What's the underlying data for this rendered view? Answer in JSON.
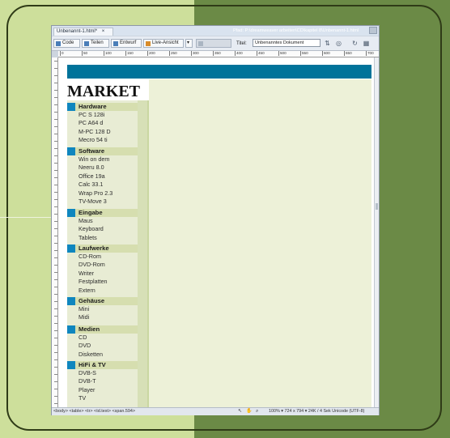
{
  "colors": {
    "bg_left": "#cddf9b",
    "bg_right": "#6b8a46",
    "accent_bar": "#00739a",
    "category_square": "#0f86be",
    "category_header": "#d6deaf",
    "sidebar": "#e8ecd4",
    "content": "#edf1d8"
  },
  "window": {
    "doc_tab": "Unbenannt-1.html*",
    "close_glyph": "×",
    "path": "Pfad: P:\\dreamweaver arbeiten\\CD\\kapitel 8\\Unbenannt-1.html"
  },
  "toolbar": {
    "code_label": "Code",
    "split_label": "Teilen",
    "design_label": "Entwurf",
    "live_view_label": "Live-Ansicht",
    "title_label": "Titel:",
    "title_value": "Unbenanntes Dokument"
  },
  "ruler": {
    "marks": [
      "0",
      "50",
      "100",
      "150",
      "200",
      "250",
      "300",
      "350",
      "400",
      "450",
      "500",
      "550",
      "600",
      "650",
      "700"
    ]
  },
  "page": {
    "title": "MARKET",
    "categories": [
      {
        "name": "Hardware",
        "items": [
          "PC S 128i",
          "PC A64 d",
          "M-PC 128 D",
          "Mecro 54 ti"
        ]
      },
      {
        "name": "Software",
        "items": [
          "Win on dem",
          "Neeru 8.0",
          "Office 19a",
          "Calc 33.1",
          "Wrap Pro 2.3",
          "TV-Move 3"
        ]
      },
      {
        "name": "Eingabe",
        "items": [
          "Maus",
          "Keyboard",
          "Tablets"
        ]
      },
      {
        "name": "Laufwerke",
        "items": [
          "CD-Rom",
          "DVD-Rom",
          "Writer",
          "Festplatten",
          "Extern"
        ]
      },
      {
        "name": "Gehäuse",
        "items": [
          "Mini",
          "Midi"
        ]
      },
      {
        "name": "Medien",
        "items": [
          "CD",
          "DVD",
          "Disketten"
        ]
      },
      {
        "name": "HiFi & TV",
        "items": [
          "DVB-S",
          "DVB-T",
          "Player",
          "TV"
        ]
      }
    ]
  },
  "statusbar": {
    "tag_path": "<body> <table> <tr> <td.text> <span.594>",
    "info": "100%  ▾  724 x 794 ▾  24K / 4 Sek  Unicode (UTF-8)"
  }
}
